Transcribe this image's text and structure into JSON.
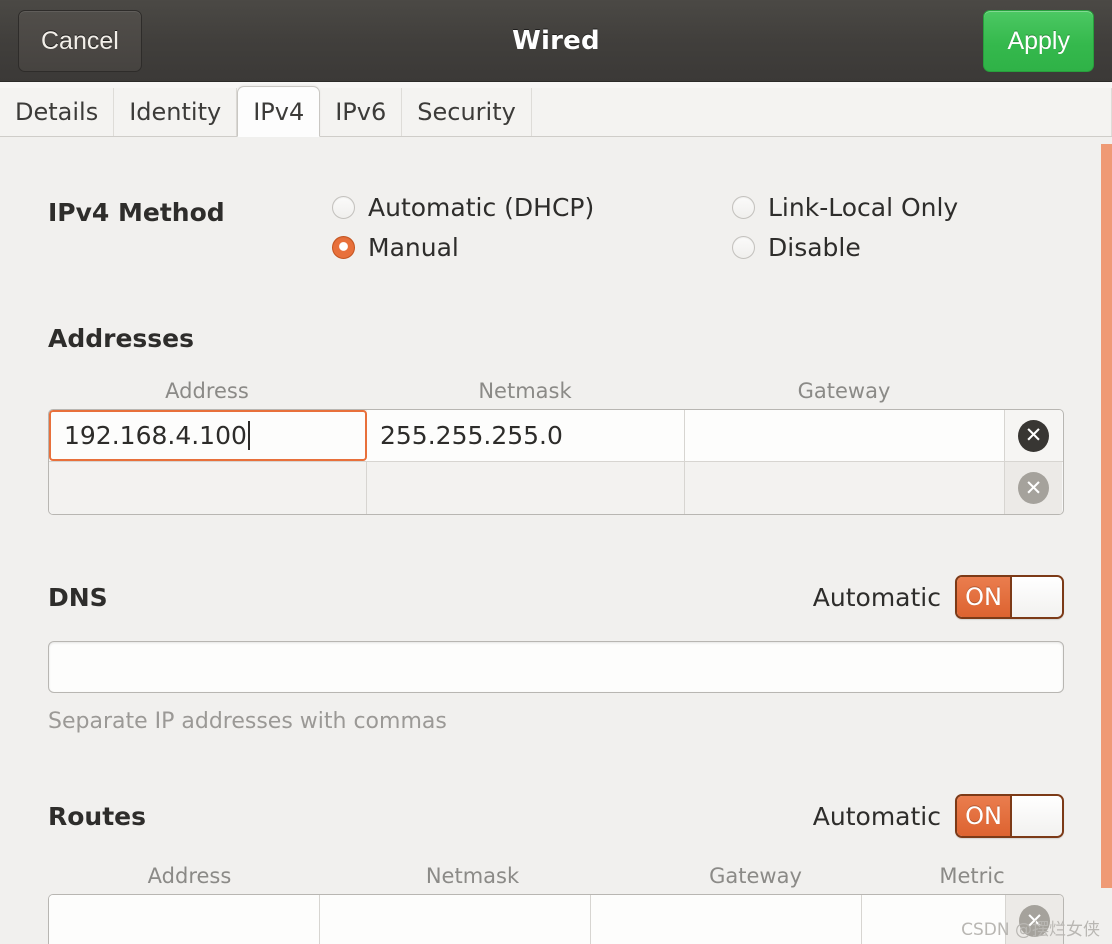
{
  "window": {
    "title": "Wired",
    "cancel_label": "Cancel",
    "apply_label": "Apply"
  },
  "tabs": [
    {
      "label": "Details",
      "active": false
    },
    {
      "label": "Identity",
      "active": false
    },
    {
      "label": "IPv4",
      "active": true
    },
    {
      "label": "IPv6",
      "active": false
    },
    {
      "label": "Security",
      "active": false
    }
  ],
  "ipv4_method": {
    "label": "IPv4 Method",
    "options": [
      {
        "label": "Automatic (DHCP)",
        "selected": false
      },
      {
        "label": "Link-Local Only",
        "selected": false
      },
      {
        "label": "Manual",
        "selected": true
      },
      {
        "label": "Disable",
        "selected": false
      }
    ],
    "selected": "Manual"
  },
  "addresses": {
    "title": "Addresses",
    "columns": [
      "Address",
      "Netmask",
      "Gateway"
    ],
    "rows": [
      {
        "address": "192.168.4.100",
        "netmask": "255.255.255.0",
        "gateway": "",
        "focused_field": "address",
        "delete_enabled": true
      },
      {
        "address": "",
        "netmask": "",
        "gateway": "",
        "focused_field": "",
        "delete_enabled": false
      }
    ],
    "delete_icon": "close-circle-icon"
  },
  "dns": {
    "title": "DNS",
    "automatic_label": "Automatic",
    "toggle_state": "ON",
    "value": "",
    "hint": "Separate IP addresses with commas"
  },
  "routes": {
    "title": "Routes",
    "automatic_label": "Automatic",
    "toggle_state": "ON",
    "columns": [
      "Address",
      "Netmask",
      "Gateway",
      "Metric"
    ],
    "rows": [
      {
        "address": "",
        "netmask": "",
        "gateway": "",
        "metric": "",
        "delete_enabled": false
      }
    ]
  },
  "colors": {
    "accent_orange": "#e8703b",
    "apply_green": "#35b94d",
    "titlebar_dark": "#413f3c",
    "page_bg": "#f1f0ee"
  },
  "watermark": "CSDN @摆烂女侠"
}
